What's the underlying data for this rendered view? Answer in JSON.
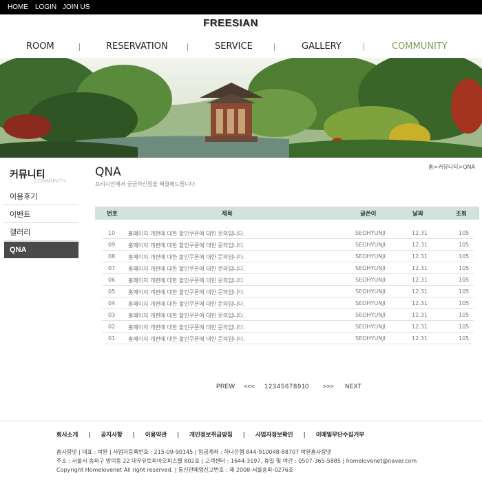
{
  "topnav": {
    "home": "HOME",
    "login": "LOGIN",
    "join": "JOIN US"
  },
  "logo": "FREESIAN",
  "mainnav": {
    "room": "ROOM",
    "reservation": "RESERVATION",
    "service": "SERVICE",
    "gallery": "GALLERY",
    "community": "COMMUNITY"
  },
  "colors": {
    "accent": "#7e9c54",
    "table_header": "#d4e2df",
    "sidebar_active": "#4a4a4a"
  },
  "sidebar": {
    "title": "커뮤니티",
    "subtitle": "COMMUNITY",
    "items": [
      "이용후기",
      "이벤트",
      "갤러리",
      "QNA"
    ]
  },
  "page": {
    "title": "QNA",
    "description": "프리시안에서 궁금하신점을 해결해드립니다.",
    "breadcrumb": "홈>커뮤니티>QNA"
  },
  "table": {
    "headers": {
      "num": "번호",
      "title": "제목",
      "author": "글쓴이",
      "date": "날짜",
      "views": "조회"
    },
    "rows": [
      {
        "num": "10",
        "title": "홈페이지 개편에 대한 할인쿠폰에 대한 문의입니다.",
        "author": "SEOHYUNJI",
        "date": "12.31",
        "views": "105"
      },
      {
        "num": "09",
        "title": "홈페이지 개편에 대한 할인쿠폰에 대한 문의입니다.",
        "author": "SEOHYUNJI",
        "date": "12.31",
        "views": "105"
      },
      {
        "num": "08",
        "title": "홈페이지 개편에 대한 할인쿠폰에 대한 문의입니다.",
        "author": "SEOHYUNJI",
        "date": "12.31",
        "views": "105"
      },
      {
        "num": "07",
        "title": "홈페이지 개편에 대한 할인쿠폰에 대한 문의입니다.",
        "author": "SEOHYUNJI",
        "date": "12.31",
        "views": "105"
      },
      {
        "num": "06",
        "title": "홈페이지 개편에 대한 할인쿠폰에 대한 문의입니다.",
        "author": "SEOHYUNJI",
        "date": "12.31",
        "views": "105"
      },
      {
        "num": "05",
        "title": "홈페이지 개편에 대한 할인쿠폰에 대한 문의입니다.",
        "author": "SEOHYUNJI",
        "date": "12.31",
        "views": "105"
      },
      {
        "num": "04",
        "title": "홈페이지 개편에 대한 할인쿠폰에 대한 문의입니다.",
        "author": "SEOHYUNJI",
        "date": "12.31",
        "views": "105"
      },
      {
        "num": "03",
        "title": "홈페이지 개편에 대한 할인쿠폰에 대한 문의입니다.",
        "author": "SEOHYUNJI",
        "date": "12.31",
        "views": "105"
      },
      {
        "num": "02",
        "title": "홈페이지 개편에 대한 할인쿠폰에 대한 문의입니다.",
        "author": "SEOHYUNJI",
        "date": "12.31",
        "views": "105"
      },
      {
        "num": "01",
        "title": "홈페이지 개편에 대한 할인쿠폰에 대한 문의입니다.",
        "author": "SEOHYUNJI",
        "date": "12.31",
        "views": "105"
      }
    ]
  },
  "pagination": {
    "prev": "PREW",
    "first": "<<<",
    "pages": [
      "1",
      "2",
      "3",
      "4",
      "5",
      "6",
      "7",
      "8",
      "9",
      "10"
    ],
    "last": ">>>",
    "next": "NEXT"
  },
  "footer": {
    "links": [
      "회사소개",
      "공지사항",
      "이용약관",
      "개인정보취급방침",
      "사업자정보확인",
      "이메일무단수집거부"
    ],
    "line1": "홈사랑넷  |  대표 : 박완  |  사업자등록번호 : 215-09-90145  |  입금계좌 : 하나은행 844-910048-88707 박완홈사랑넷",
    "line2": "주소 : 서울시 송파구 방이동 22 대우유토피아오피스텔 802호  |  고객센터 : 1644-3197, 휴일 및 야간 : 0507-365-5885  |  homelovenet@naver.com",
    "line3": "Copyright Homelovenet All right reserved.  |  통신판매업신고번호 : 제 2008-서울송파-0276호"
  }
}
